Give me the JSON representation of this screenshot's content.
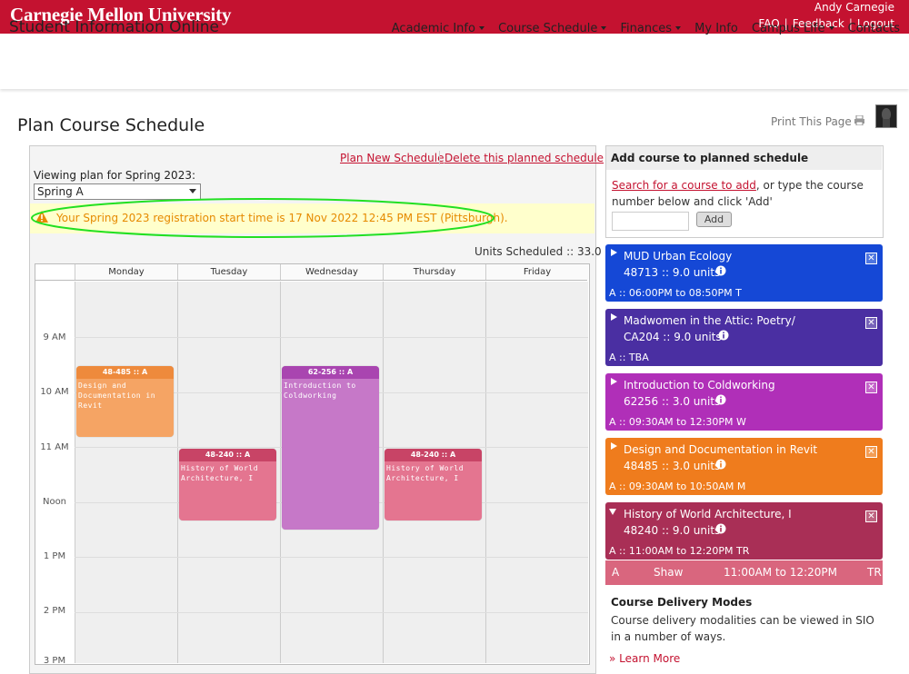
{
  "header": {
    "logo": "Carnegie Mellon University",
    "user": "Andy Carnegie",
    "links": [
      "FAQ",
      "Feedback",
      "Logout"
    ]
  },
  "nav": {
    "app_title": "Student Information Online",
    "items": [
      "Academic Info",
      "Course Schedule",
      "Finances",
      "My Info",
      "Campus Life",
      "Contacts"
    ]
  },
  "page": {
    "title": "Plan Course Schedule",
    "print": "Print This Page"
  },
  "plan": {
    "new_link": "Plan New Schedule",
    "delete_link": "Delete this planned schedule",
    "viewing_label": "Viewing plan for Spring 2023:",
    "selected": "Spring A",
    "alert": "Your Spring 2023 registration start time is 17 Nov 2022 12:45 PM EST (Pittsburgh).",
    "units": "Units Scheduled :: 33.0"
  },
  "calendar": {
    "days": [
      "Monday",
      "Tuesday",
      "Wednesday",
      "Thursday",
      "Friday"
    ],
    "times": [
      "9 AM",
      "10 AM",
      "11 AM",
      "Noon",
      "1 PM",
      "2 PM",
      "3 PM"
    ],
    "events": [
      {
        "code": "48-485 :: A",
        "title": "Design and Documentation in Revit",
        "color": "#f0a060"
      },
      {
        "code": "48-240 :: A",
        "title": "History of World Architecture, I",
        "color": "#e0708e"
      },
      {
        "code": "62-256 :: A",
        "title": "Introduction to Coldworking",
        "color": "#c070c8"
      },
      {
        "code": "48-240 :: A",
        "title": "History of World Architecture, I",
        "color": "#e0708e"
      }
    ]
  },
  "add": {
    "title": "Add course to planned schedule",
    "search_link": "Search for a course to add",
    "desc": ", or type the course number below and click 'Add'",
    "button": "Add"
  },
  "courses": [
    {
      "title": "MUD Urban Ecology",
      "units": "48713 :: 9.0 units",
      "time": "A :: 06:00PM to 08:50PM T",
      "color": "#1548d6"
    },
    {
      "title": "Madwomen in the Attic: Poetry/",
      "units": "CA204 :: 9.0 units",
      "time": "A :: TBA",
      "color": "#4a2fa2"
    },
    {
      "title": "Introduction to Coldworking",
      "units": "62256 :: 3.0 units",
      "time": "A :: 09:30AM to 12:30PM W",
      "color": "#b02fb8"
    },
    {
      "title": "Design and Documentation in Revit",
      "units": "48485 :: 3.0 units",
      "time": "A :: 09:30AM to 10:50AM M",
      "color": "#ef7c1d"
    },
    {
      "title": "History of World Architecture, I",
      "units": "48240 :: 9.0 units",
      "time": "A :: 11:00AM to 12:20PM TR",
      "color": "#a92f56"
    }
  ],
  "hwa_detail": {
    "section": "A",
    "instructor": "Shaw",
    "time": "11:00AM to 12:20PM",
    "days": "TR"
  },
  "delivery": {
    "title": "Course Delivery Modes",
    "desc": "Course delivery modalities can be viewed in SIO in a number of ways.",
    "learn_more": "» Learn More"
  }
}
